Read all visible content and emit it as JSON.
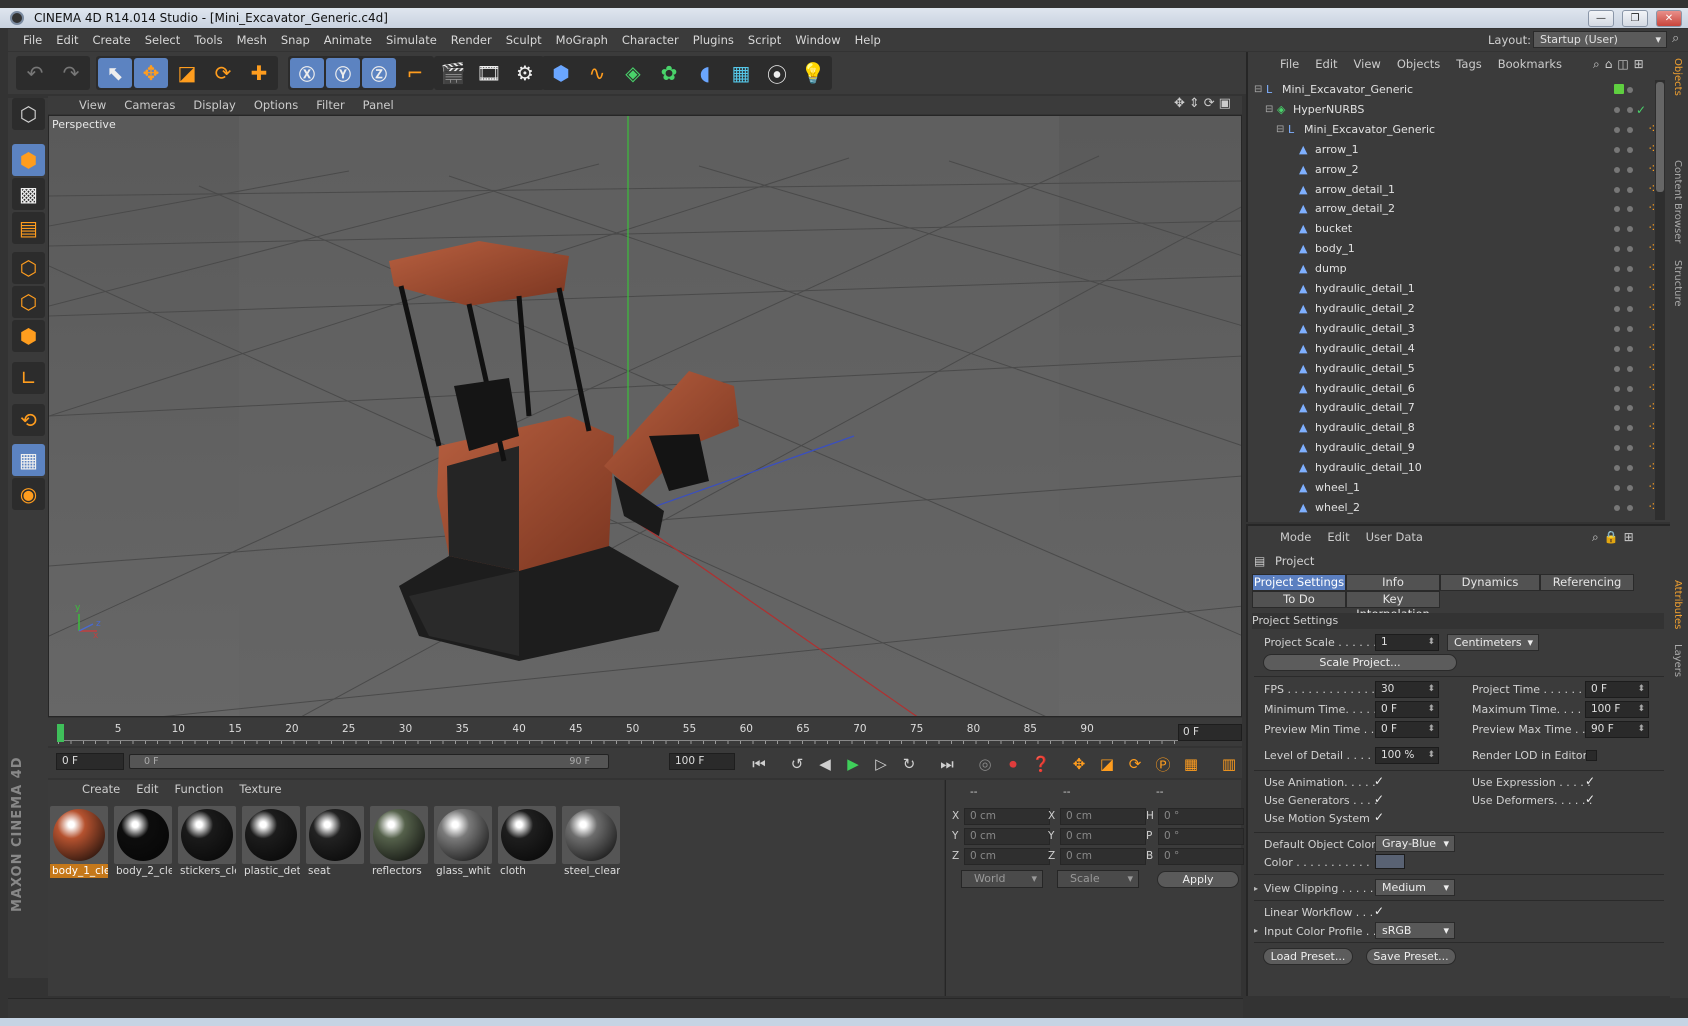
{
  "window": {
    "title": "CINEMA 4D R14.014 Studio - [Mini_Excavator_Generic.c4d]",
    "min": "—",
    "max": "❐",
    "close": "✕"
  },
  "menu": [
    "File",
    "Edit",
    "Create",
    "Select",
    "Tools",
    "Mesh",
    "Snap",
    "Animate",
    "Simulate",
    "Render",
    "Sculpt",
    "MoGraph",
    "Character",
    "Plugins",
    "Script",
    "Window",
    "Help"
  ],
  "layout": {
    "label": "Layout:",
    "value": "Startup (User)"
  },
  "viewport": {
    "menu": [
      "View",
      "Cameras",
      "Display",
      "Options",
      "Filter",
      "Panel"
    ],
    "label": "Perspective",
    "axis": {
      "x": "x",
      "y": "y",
      "z": "z"
    }
  },
  "timeline": {
    "ticks": [
      "0",
      "5",
      "10",
      "15",
      "20",
      "25",
      "30",
      "35",
      "40",
      "45",
      "50",
      "55",
      "60",
      "65",
      "70",
      "75",
      "80",
      "85",
      "90"
    ],
    "current_frame": "0 F",
    "range_start": "0 F",
    "range_slider_start": "0 F",
    "range_slider_end": "90 F",
    "range_end": "100 F"
  },
  "materials": {
    "menu": [
      "Create",
      "Edit",
      "Function",
      "Texture"
    ],
    "items": [
      {
        "label": "body_1_cle",
        "color": "#b5522f"
      },
      {
        "label": "body_2_cle",
        "color": "#0d0d0d"
      },
      {
        "label": "stickers_cle",
        "color": "#1a1a1a"
      },
      {
        "label": "plastic_det",
        "color": "#1c1c1c"
      },
      {
        "label": "seat",
        "color": "#222222"
      },
      {
        "label": "reflectors",
        "color": "#55614b"
      },
      {
        "label": "glass_whit",
        "color": "#7a7a7a"
      },
      {
        "label": "cloth",
        "color": "#1e1e1e"
      },
      {
        "label": "steel_clean",
        "color": "#6d6d6d"
      }
    ]
  },
  "coords": {
    "headers": [
      "--",
      "--",
      "--"
    ],
    "rows": [
      {
        "a": "X",
        "av": "0 cm",
        "b": "X",
        "bv": "0 cm",
        "c": "H",
        "cv": "0 °"
      },
      {
        "a": "Y",
        "av": "0 cm",
        "b": "Y",
        "bv": "0 cm",
        "c": "P",
        "cv": "0 °"
      },
      {
        "a": "Z",
        "av": "0 cm",
        "b": "Z",
        "bv": "0 cm",
        "c": "B",
        "cv": "0 °"
      }
    ],
    "mode1": "World",
    "mode2": "Scale",
    "apply": "Apply"
  },
  "objects": {
    "menu": [
      "File",
      "Edit",
      "View",
      "Objects",
      "Tags",
      "Bookmarks"
    ],
    "tree": [
      {
        "name": "Mini_Excavator_Generic",
        "level": 0
      },
      {
        "name": "HyperNURBS",
        "level": 1
      },
      {
        "name": "Mini_Excavator_Generic",
        "level": 2
      },
      {
        "name": "arrow_1",
        "level": 3
      },
      {
        "name": "arrow_2",
        "level": 3
      },
      {
        "name": "arrow_detail_1",
        "level": 3
      },
      {
        "name": "arrow_detail_2",
        "level": 3
      },
      {
        "name": "bucket",
        "level": 3
      },
      {
        "name": "body_1",
        "level": 3
      },
      {
        "name": "dump",
        "level": 3
      },
      {
        "name": "hydraulic_detail_1",
        "level": 3
      },
      {
        "name": "hydraulic_detail_2",
        "level": 3
      },
      {
        "name": "hydraulic_detail_3",
        "level": 3
      },
      {
        "name": "hydraulic_detail_4",
        "level": 3
      },
      {
        "name": "hydraulic_detail_5",
        "level": 3
      },
      {
        "name": "hydraulic_detail_6",
        "level": 3
      },
      {
        "name": "hydraulic_detail_7",
        "level": 3
      },
      {
        "name": "hydraulic_detail_8",
        "level": 3
      },
      {
        "name": "hydraulic_detail_9",
        "level": 3
      },
      {
        "name": "hydraulic_detail_10",
        "level": 3
      },
      {
        "name": "wheel_1",
        "level": 3
      },
      {
        "name": "wheel_2",
        "level": 3
      }
    ]
  },
  "right_tabs": [
    "Objects",
    "Content Browser",
    "Structure",
    "Attributes",
    "Layers"
  ],
  "attributes": {
    "menu": [
      "Mode",
      "Edit",
      "User Data"
    ],
    "object": "Project",
    "tabs": [
      "Project Settings",
      "Info",
      "Dynamics",
      "Referencing",
      "To Do",
      "Key Interpolation"
    ],
    "section": "Project Settings",
    "project_scale": {
      "label": "Project Scale . . . . . .",
      "value": "1",
      "unit": "Centimeters"
    },
    "scale_button": "Scale Project...",
    "fps": {
      "label": "FPS . . . . . . . . . . . . . .",
      "value": "30"
    },
    "project_time": {
      "label": "Project Time . . . . . . . .",
      "value": "0 F"
    },
    "min_time": {
      "label": "Minimum Time. . . . .",
      "value": "0 F"
    },
    "max_time": {
      "label": "Maximum Time. . . . . .",
      "value": "100 F"
    },
    "prev_min": {
      "label": "Preview Min Time . . .",
      "value": "0 F"
    },
    "prev_max": {
      "label": "Preview Max Time . . .",
      "value": "90 F"
    },
    "lod": {
      "label": "Level of Detail . . . . .",
      "value": "100 %"
    },
    "render_lod": {
      "label": "Render LOD in Editor"
    },
    "use_animation": "Use Animation. . . . .",
    "use_expression": "Use Expression . . . . .",
    "use_generators": "Use Generators . . . .",
    "use_deformers": "Use Deformers. . . . . .",
    "use_motion": "Use Motion System",
    "default_color": {
      "label": "Default Object Color",
      "value": "Gray-Blue"
    },
    "color": {
      "label": "Color . . . . . . . . . . ."
    },
    "view_clipping": {
      "label": "View Clipping . . . . . .",
      "value": "Medium"
    },
    "linear_workflow": "Linear Workflow . . .",
    "input_profile": {
      "label": "Input Color Profile . .",
      "value": "sRGB"
    },
    "load_preset": "Load Preset...",
    "save_preset": "Save Preset..."
  }
}
